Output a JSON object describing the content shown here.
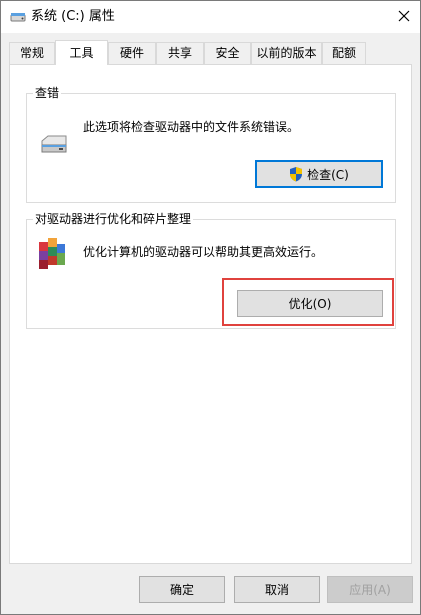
{
  "window": {
    "title": "系统 (C:) 属性",
    "close_glyph": "✕"
  },
  "tabs": [
    {
      "label": "常规",
      "active": false
    },
    {
      "label": "工具",
      "active": true
    },
    {
      "label": "硬件",
      "active": false
    },
    {
      "label": "共享",
      "active": false
    },
    {
      "label": "安全",
      "active": false
    },
    {
      "label": "以前的版本",
      "active": false
    },
    {
      "label": "配额",
      "active": false
    }
  ],
  "error_check": {
    "title": "查错",
    "description": "此选项将检查驱动器中的文件系统错误。",
    "button_label": "检查(C)",
    "icon": "drive-icon"
  },
  "optimize": {
    "title": "对驱动器进行优化和碎片整理",
    "description": "优化计算机的驱动器可以帮助其更高效运行。",
    "button_label": "优化(O)",
    "icon": "defrag-icon",
    "highlight_color": "#e0423d"
  },
  "footer": {
    "ok_label": "确定",
    "cancel_label": "取消",
    "apply_label": "应用(A)"
  },
  "colors": {
    "accent": "#0078d7",
    "shield_blue": "#1f5fbf",
    "shield_yellow": "#f2c100"
  }
}
